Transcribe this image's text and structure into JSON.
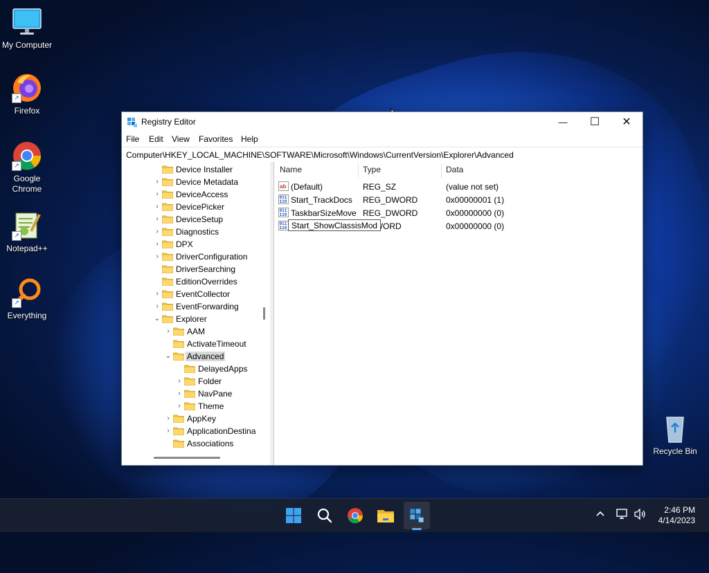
{
  "desktop": {
    "icons": [
      {
        "label": "My Computer",
        "icon": "computer-icon"
      },
      {
        "label": "Firefox",
        "icon": "firefox-icon"
      },
      {
        "label": "Google Chrome",
        "icon": "chrome-icon"
      },
      {
        "label": "Notepad++",
        "icon": "notepadpp-icon"
      },
      {
        "label": "Everything",
        "icon": "everything-icon"
      },
      {
        "label": "Recycle Bin",
        "icon": "recycle-bin-icon"
      }
    ]
  },
  "window": {
    "title": "Registry Editor",
    "controls": {
      "minimize": "—",
      "maximize": "☐",
      "close": "✕"
    },
    "menu": [
      "File",
      "Edit",
      "View",
      "Favorites",
      "Help"
    ],
    "address": "Computer\\HKEY_LOCAL_MACHINE\\SOFTWARE\\Microsoft\\Windows\\CurrentVersion\\Explorer\\Advanced",
    "tree": [
      {
        "label": "Device Installer",
        "expander": ""
      },
      {
        "label": "Device Metadata",
        "expander": ">"
      },
      {
        "label": "DeviceAccess",
        "expander": ">"
      },
      {
        "label": "DevicePicker",
        "expander": ">"
      },
      {
        "label": "DeviceSetup",
        "expander": ">"
      },
      {
        "label": "Diagnostics",
        "expander": ">"
      },
      {
        "label": "DPX",
        "expander": ">"
      },
      {
        "label": "DriverConfiguration",
        "expander": ">"
      },
      {
        "label": "DriverSearching",
        "expander": ""
      },
      {
        "label": "EditionOverrides",
        "expander": ""
      },
      {
        "label": "EventCollector",
        "expander": ">"
      },
      {
        "label": "EventForwarding",
        "expander": ">"
      },
      {
        "label": "Explorer",
        "expander": "v"
      },
      {
        "label": "AAM",
        "expander": ">"
      },
      {
        "label": "ActivateTimeout",
        "expander": ""
      },
      {
        "label": "Advanced",
        "expander": "v",
        "selected": true
      },
      {
        "label": "DelayedApps",
        "expander": ""
      },
      {
        "label": "Folder",
        "expander": ">"
      },
      {
        "label": "NavPane",
        "expander": ">"
      },
      {
        "label": "Theme",
        "expander": ">"
      },
      {
        "label": "AppKey",
        "expander": ">"
      },
      {
        "label": "ApplicationDestina",
        "expander": ">"
      },
      {
        "label": "Associations",
        "expander": ""
      }
    ],
    "columns": {
      "name": "Name",
      "type": "Type",
      "data": "Data"
    },
    "values": [
      {
        "name": "(Default)",
        "type": "REG_SZ",
        "data": "(value not set)",
        "icon": "string-value-icon"
      },
      {
        "name": "Start_TrackDocs",
        "type": "REG_DWORD",
        "data": "0x00000001 (1)",
        "icon": "dword-value-icon"
      },
      {
        "name": "TaskbarSizeMove",
        "type": "REG_DWORD",
        "data": "0x00000000 (0)",
        "icon": "dword-value-icon"
      },
      {
        "name": "",
        "type": "DWORD",
        "data": "0x00000000 (0)",
        "icon": "dword-value-icon"
      }
    ],
    "rename_text": "Start_ShowClassisMod"
  },
  "taskbar": {
    "clock_time": "2:46 PM",
    "clock_date": "4/14/2023"
  }
}
